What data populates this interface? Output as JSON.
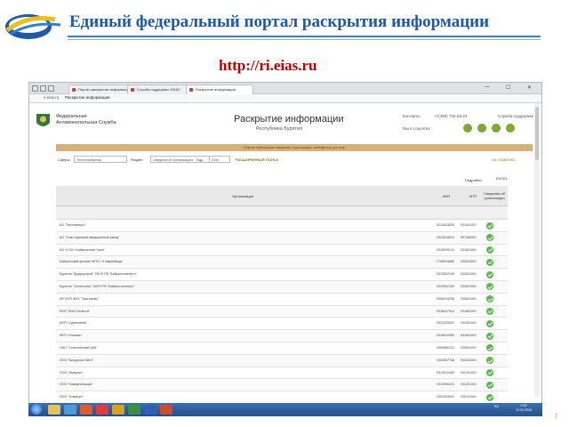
{
  "slide": {
    "title": "Единый федеральный портал раскрытия информации",
    "url": "http://ri.eias.ru"
  },
  "browser": {
    "tabs": [
      {
        "label": "Портал раскрытия информации",
        "active": false
      },
      {
        "label": "Служба поддержки: ЕИАС",
        "active": false
      },
      {
        "label": "Раскрытие информации",
        "active": true
      }
    ],
    "address_domain": "ri.eias.ru",
    "address_title": "Раскрытие информации"
  },
  "site": {
    "org_name": "Федеральная Антимонопольная Служба",
    "title": "Раскрытие информации",
    "region": "Республика Бурятия",
    "contacts_label": "Контакты",
    "phone": "+7(499) 755-23-23",
    "support_label": "Служба поддержки",
    "social_label": "Мы в соцсетях:",
    "banner": "Портал публикации сведений, подлежащих свободному доступу"
  },
  "filters": {
    "sphere_label": "Сфера:",
    "sphere_value": "Теплоснабжение",
    "section_label": "Раздел:",
    "section_value": "Сведения об организациях",
    "year_label": "Год:",
    "year_value": "2016",
    "advanced_search": "РАСШИРЕННЫЙ ПОИСК",
    "home_link": "НА ГЛАВНУЮ"
  },
  "table": {
    "detail_label": "Подробно:",
    "excel_label": "EXCEL",
    "columns": [
      "Организация",
      "ИНН",
      "КПП",
      "Сведения об организации"
    ],
    "rows": [
      {
        "name": "АО \"Теплоэнерго\"",
        "inn": "0314003520",
        "kpp": "031401001"
      },
      {
        "name": "АО \"Улан-Удэнский авиационный завод\"",
        "inn": "0323018510",
        "kpp": "997450001"
      },
      {
        "name": "АО «ССК» Байкальская \"своя\"",
        "inn": "0318009141",
        "kpp": "031801001"
      },
      {
        "name": "Байкальский филиал ФГБУ «Главрыбвод»",
        "inn": "7708044880",
        "kpp": "032643001"
      },
      {
        "name": "Бурятия \"Бурдорстрой\" ОКУП РБ \"Байкалгосэнерго\"",
        "inn": "0323502109",
        "kpp": "032601001"
      },
      {
        "name": "Бурятия \"Селенгинск\" ОКУП РБ \"Байкалгосэнерго\"",
        "inn": "0323502109",
        "kpp": "032601001"
      },
      {
        "name": "МУ МУП ЖКХ \"Заиграево\"",
        "inn": "0306014258",
        "kpp": "030601001"
      },
      {
        "name": "МУП \"ЖКХ Селенга\"",
        "inn": "0318447914",
        "kpp": "031801001"
      },
      {
        "name": "МУП \"Суранчеево\"",
        "inn": "0323325022",
        "kpp": "032301001"
      },
      {
        "name": "МУП «Улыкан»",
        "inn": "0316010089",
        "kpp": "031601001"
      },
      {
        "name": "ОАО \"Селенгинский ЦКК\"",
        "inn": "0309980131",
        "kpp": "030901001"
      },
      {
        "name": "ООО \"Бичурское ЖКХ\"",
        "inn": "0303507746",
        "kpp": "030301001"
      },
      {
        "name": "ООО \"Импульс\"",
        "inn": "0312010430",
        "kpp": "031201001"
      },
      {
        "name": "ООО \"Коммунальщик\"",
        "inn": "0312006110",
        "kpp": "031201001"
      },
      {
        "name": "ООО \"Комфорт\"",
        "inn": "0301003941",
        "kpp": "030101001"
      }
    ]
  },
  "taskbar": {
    "tray_lang": "RU",
    "time": "9:05",
    "date": "12.04.2016"
  },
  "page_number": "7",
  "colors": {
    "title_blue": "#1f58a8",
    "url_red": "#c00000",
    "banner_tan": "#d6b27a",
    "accent_green": "#7ea832",
    "check_green": "#5eb84f",
    "taskbar_blue": "#3c6fb3"
  }
}
